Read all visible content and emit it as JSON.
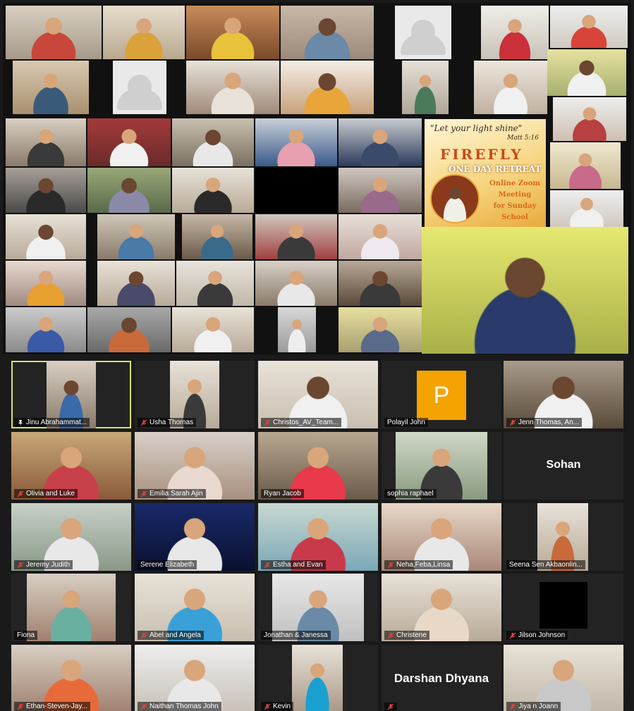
{
  "collage_poster": {
    "verse": "\"Let your light shine\"",
    "reference": "Matt 5:16",
    "title": "FIREFLY",
    "subtitle": "ONE DAY RETREAT",
    "body_lines": [
      "Online Zoom",
      "Meeting",
      "for Sunday",
      "School"
    ]
  },
  "participants": [
    {
      "name": "Jinu Abrahammat...",
      "muted": false,
      "pinned": true,
      "speaking": true
    },
    {
      "name": "Usha Thomas",
      "muted": true
    },
    {
      "name": "Christos_AV_Team...",
      "muted": true
    },
    {
      "name": "Polayil John",
      "muted": false,
      "initial": "P"
    },
    {
      "name": "Jenn Thomas, An...",
      "muted": true
    },
    {
      "name": "Olivia and Luke",
      "muted": true
    },
    {
      "name": "Emilia Sarah Ajin",
      "muted": true
    },
    {
      "name": "Ryan Jacob",
      "muted": false
    },
    {
      "name": "sophia raphael",
      "muted": false
    },
    {
      "name": "Sohan",
      "muted": false,
      "video_off": true
    },
    {
      "name": "Jeremy Judith",
      "muted": true
    },
    {
      "name": "Serene Elizabeth",
      "muted": false
    },
    {
      "name": "Estha and Evan",
      "muted": true
    },
    {
      "name": "Neha,Feba,Linsa",
      "muted": true
    },
    {
      "name": "Seena Sen Akbaonlin...",
      "muted": false
    },
    {
      "name": "Fiona",
      "muted": false
    },
    {
      "name": "Abel and Angela",
      "muted": true
    },
    {
      "name": "Jonathan & Janessa",
      "muted": false
    },
    {
      "name": "Christene",
      "muted": true
    },
    {
      "name": "Jilson Johnson",
      "muted": true
    },
    {
      "name": "Ethan-Steven-Jay...",
      "muted": true
    },
    {
      "name": "Naithan Thomas John",
      "muted": true
    },
    {
      "name": "Kevin",
      "muted": true
    },
    {
      "name": "Darshan Dhyana",
      "muted": true,
      "video_off": true
    },
    {
      "name": "Jiya n Joann",
      "muted": true
    }
  ],
  "colors": {
    "speaking_border": "#d8e16a",
    "mic_muted": "#e0443a",
    "initial_avatar": "#f4a300"
  },
  "icons": [
    "pin-icon",
    "mic-off-icon"
  ]
}
